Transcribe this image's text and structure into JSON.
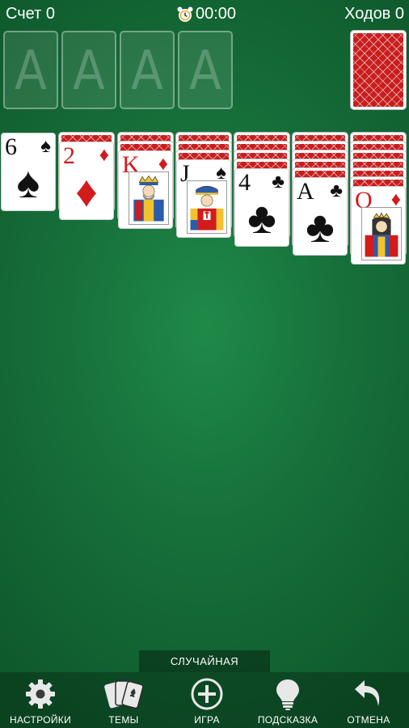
{
  "header": {
    "score": "Счет 0",
    "timer": "00:00",
    "moves": "Ходов 0"
  },
  "foundations": [
    {
      "label": "A"
    },
    {
      "label": "A"
    },
    {
      "label": "A"
    },
    {
      "label": "A"
    }
  ],
  "tableau": [
    {
      "hidden": 0,
      "top": {
        "rank": "6",
        "suit": "♠",
        "color": "black"
      }
    },
    {
      "hidden": 1,
      "top": {
        "rank": "2",
        "suit": "♦",
        "color": "red"
      }
    },
    {
      "hidden": 2,
      "top": {
        "rank": "K",
        "suit": "♦",
        "color": "red",
        "face": "king"
      }
    },
    {
      "hidden": 3,
      "top": {
        "rank": "J",
        "suit": "♠",
        "color": "black",
        "face": "jack"
      }
    },
    {
      "hidden": 4,
      "top": {
        "rank": "4",
        "suit": "♣",
        "color": "black"
      }
    },
    {
      "hidden": 5,
      "top": {
        "rank": "A",
        "suit": "♣",
        "color": "black"
      }
    },
    {
      "hidden": 6,
      "top": {
        "rank": "Q",
        "suit": "♦",
        "color": "red",
        "face": "queen"
      }
    }
  ],
  "mode_tab": "СЛУЧАЙНАЯ",
  "toolbar": {
    "settings": "НАСТРОЙКИ",
    "themes": "ТЕМЫ",
    "new_game": "ИГРА",
    "hint": "ПОДСКАЗКА",
    "undo": "ОТМЕНА"
  },
  "colors": {
    "felt": "#1f8a49",
    "card_back": "#c81e1e",
    "red_suit": "#d21b1b"
  },
  "icons": [
    "alarm-clock-icon",
    "gear-icon",
    "cards-icon",
    "plus-circle-icon",
    "lightbulb-icon",
    "undo-arrow-icon"
  ]
}
